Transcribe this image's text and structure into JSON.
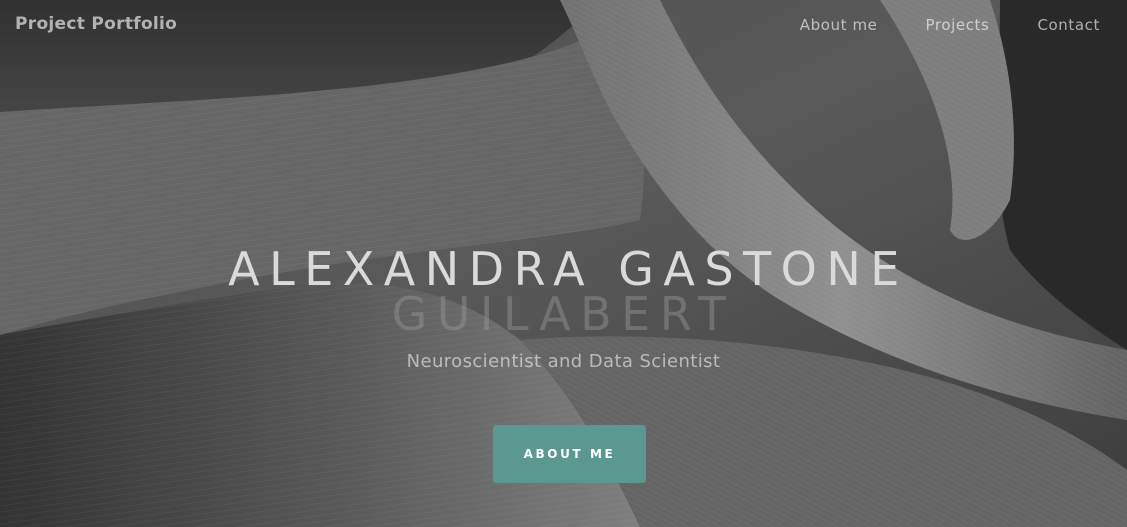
{
  "nav": {
    "brand": "Project Portfolio",
    "links": [
      {
        "label": "About me"
      },
      {
        "label": "Projects"
      },
      {
        "label": "Contact"
      }
    ]
  },
  "hero": {
    "name_line1": "Alexandra Gastone",
    "name_line2": "Guilabert",
    "subtitle": "Neuroscientist and Data Scientist",
    "cta_label": "About me",
    "cta_color": "#5a9890"
  }
}
